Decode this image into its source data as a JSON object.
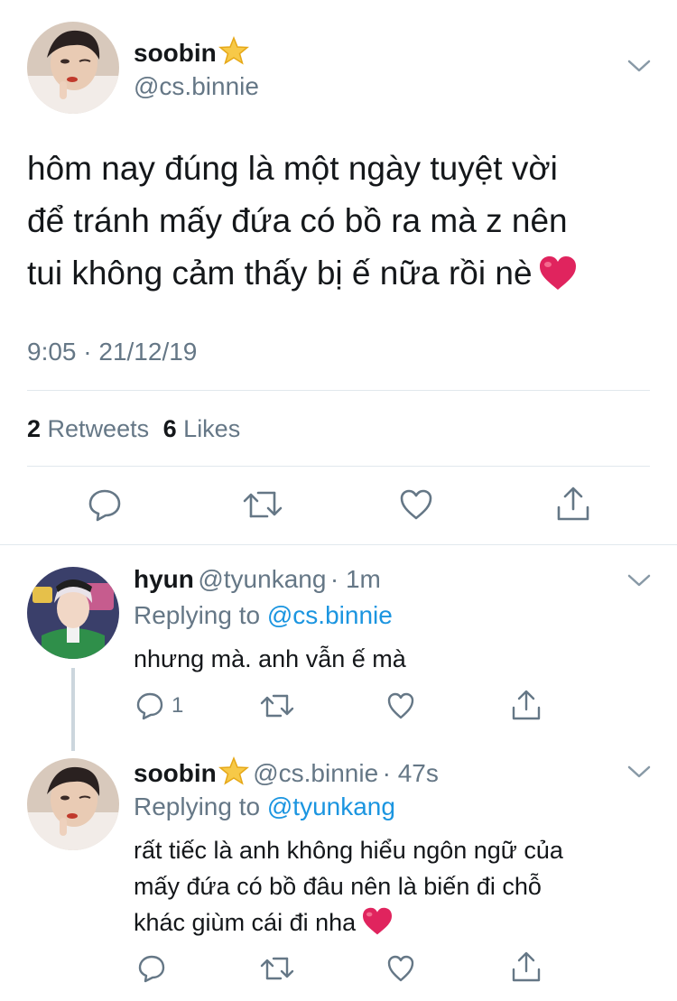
{
  "main_tweet": {
    "author_name": "soobin",
    "author_handle": "@cs.binnie",
    "text_lines": [
      "hôm nay đúng là một ngày tuyệt vời",
      "để tránh mấy đứa có bồ ra mà z nên",
      "tui không cảm thấy bị ế nữa rồi nè"
    ],
    "timestamp": "9:05 · 21/12/19",
    "retweet_count": "2",
    "retweet_label": "Retweets",
    "like_count": "6",
    "like_label": "Likes"
  },
  "replies": [
    {
      "author_name": "hyun",
      "author_handle": "@tyunkang",
      "time": "· 1m",
      "replying_to_label": "Replying to",
      "replying_to_handle": "@cs.binnie",
      "text_lines": [
        "nhưng mà. anh vẫn ế mà"
      ],
      "reply_count": "1"
    },
    {
      "author_name": "soobin",
      "author_handle": "@cs.binnie",
      "time": "· 47s",
      "replying_to_label": "Replying to",
      "replying_to_handle": "@tyunkang",
      "text_lines": [
        "rất tiếc là anh không hiểu ngôn ngữ của",
        "mấy đứa có bồ đâu nên là biến đi chỗ",
        "khác giùm cái đi nha"
      ]
    }
  ],
  "icons": {
    "reply": "speech-bubble",
    "retweet": "retweet-arrows",
    "like": "heart-outline",
    "share": "share-upload",
    "menu": "chevron-down",
    "star_emoji": "star",
    "heart_emoji": "red-heart"
  },
  "colors": {
    "text": "#14171a",
    "secondary": "#657786",
    "link": "#1b95e0",
    "divider": "#e1e8ed",
    "star": "#f7c948",
    "heart_emoji": "#e0245e"
  }
}
